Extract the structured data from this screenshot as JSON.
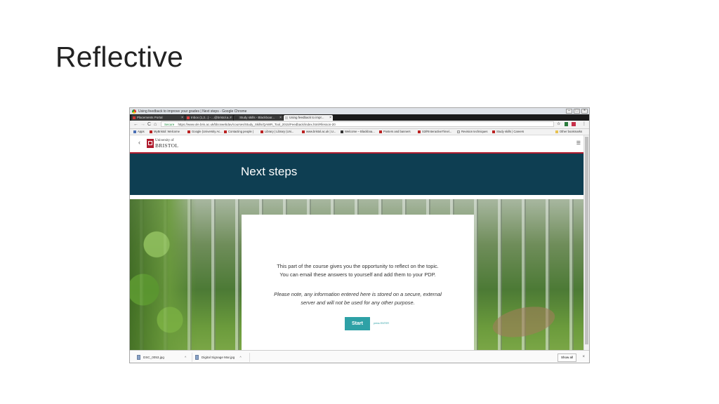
{
  "slide": {
    "title": "Reflective"
  },
  "browser": {
    "window_title": "Using feedback to improve your grades | Next steps - Google Chrome",
    "tabs": [
      {
        "label": "Placements Portal"
      },
      {
        "label": "Inbox (1,2...) - ...@bristol.a..."
      },
      {
        "label": "Study skills - Blackboar..."
      },
      {
        "label": "Using feedback to impr..."
      }
    ],
    "nav": {
      "back": "←",
      "forward": "→",
      "reload": "C",
      "home": "⌂"
    },
    "address": {
      "secure_label": "Secure",
      "url": "https://www.ole.bris.ac.uk/bbcswebdav/courses/Study_Skills/QAWR_Tool_2015/Feedback/index.html#/lesson-20"
    },
    "right_icons": {
      "star": "☆",
      "more": "⋮"
    },
    "bookmarks": [
      "Apps",
      "MyBristol: Welcome",
      "Google (University Ac...",
      "Contacting people |",
      "Library | Library (Uni...",
      "www.bristol.ac.uk | U...",
      "Welcome – Blackboa...",
      "Posters and banners",
      "S3/RInteractiveTimel...",
      "Revision techniques",
      "Study skills | Careers",
      "Other bookmarks"
    ]
  },
  "site": {
    "logo_line1": "University of",
    "logo_line2": "BRISTOL",
    "back_label": "‹",
    "menu_icon": "☰",
    "banner_title": "Next steps",
    "card": {
      "p1_line1": "This part of the course gives you the opportunity to reflect on the topic.",
      "p1_line2": "You can email these answers to yourself and add them to your PDP.",
      "p2_line1": "Please note, any information entered here is stored on a secure, external",
      "p2_line2": "server and will not be used for any other purpose.",
      "start_label": "Start",
      "enter_hint": "press ENTER"
    }
  },
  "downloads": {
    "items": [
      {
        "name": "DSC_0053.jpg"
      },
      {
        "name": "Digital Signage Mar.jpg"
      }
    ],
    "chevron": "^",
    "show_all": "Show all",
    "close": "×"
  }
}
